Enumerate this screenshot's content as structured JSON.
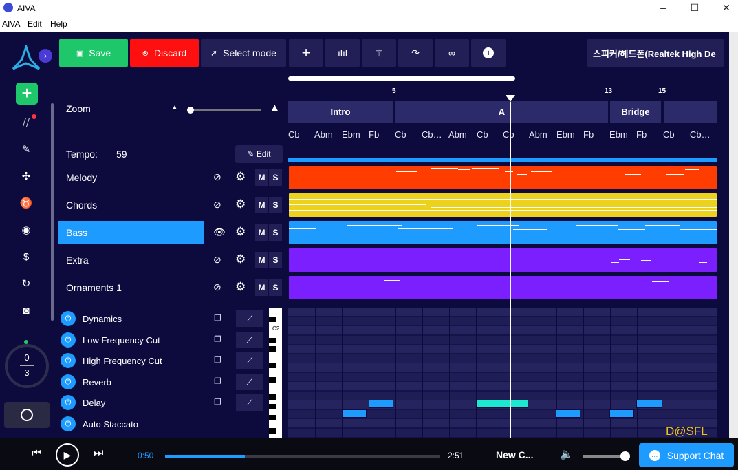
{
  "window": {
    "title": "AIVA"
  },
  "menu": [
    "AIVA",
    "Edit",
    "Help"
  ],
  "toolbar": {
    "save": "Save",
    "discard": "Discard",
    "select_mode": "Select mode",
    "audio_device": "스피커/헤드폰(Realtek High De"
  },
  "zoom": {
    "label": "Zoom",
    "level": 0.05
  },
  "tempo": {
    "label": "Tempo:",
    "value": "59",
    "edit": "Edit"
  },
  "tracks": [
    {
      "name": "Melody",
      "color": "#ff3d00",
      "visible": false,
      "m": "M",
      "s": "S"
    },
    {
      "name": "Chords",
      "color": "#ecd21a",
      "visible": false,
      "m": "M",
      "s": "S"
    },
    {
      "name": "Bass",
      "color": "#1e9bff",
      "visible": true,
      "selected": true,
      "m": "M",
      "s": "S"
    },
    {
      "name": "Extra",
      "color": "#7b1fff",
      "visible": false,
      "m": "M",
      "s": "S"
    },
    {
      "name": "Ornaments 1",
      "color": "#7b1fff",
      "visible": false,
      "m": "M",
      "s": "S"
    }
  ],
  "effects": [
    "Dynamics",
    "Low Frequency Cut",
    "High Frequency Cut",
    "Reverb",
    "Delay",
    "Auto Staccato"
  ],
  "timeline": {
    "measures": [
      "5",
      "13",
      "15"
    ],
    "sections": [
      "Intro",
      "A",
      "Bridge"
    ],
    "chords": [
      "Cb",
      "Abm",
      "Ebm",
      "Fb",
      "Cb",
      "Cb…",
      "Abm",
      "Cb",
      "Cb",
      "Abm",
      "Ebm",
      "Fb",
      "Ebm",
      "Fb",
      "Cb",
      "Cb…"
    ]
  },
  "keyboard": {
    "c_label": "C2"
  },
  "counter": {
    "top": "0",
    "bottom": "3"
  },
  "watermark": "D@SFL",
  "player": {
    "current": "0:50",
    "total": "2:51",
    "title": "New C...",
    "progress": 0.29,
    "volume": 1.0
  },
  "support": "Support Chat",
  "colors": {
    "save": "#1ec86a",
    "discard": "#ff1010",
    "accent": "#1e9bff",
    "bg": "#0d0b3e"
  }
}
